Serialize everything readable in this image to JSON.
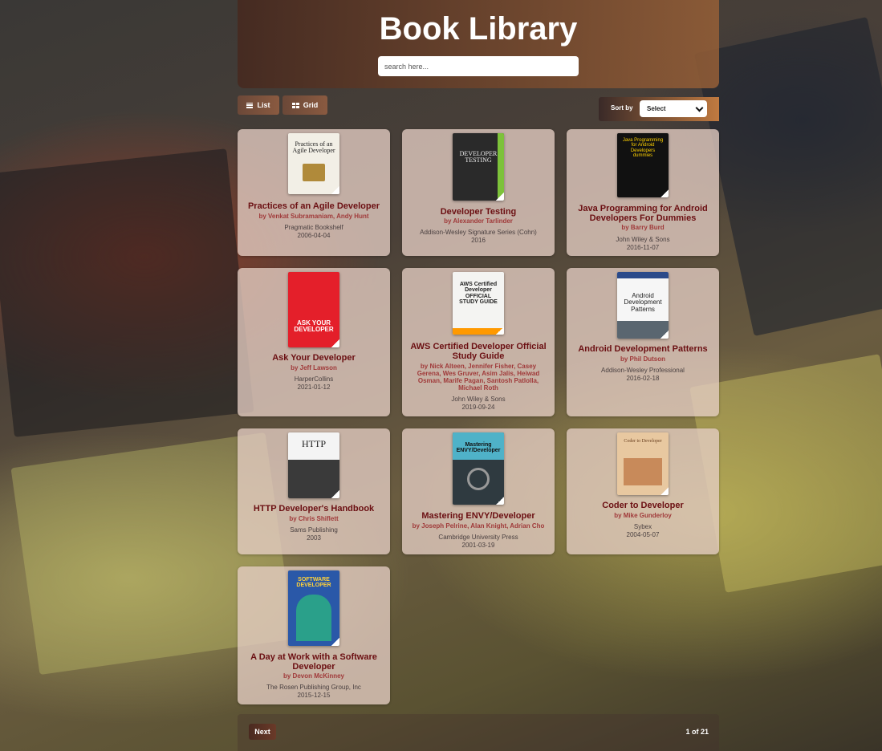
{
  "header": {
    "title": "Book Library",
    "search_placeholder": "search here..."
  },
  "view": {
    "list_label": "List",
    "grid_label": "Grid"
  },
  "sort": {
    "label": "Sort by",
    "selected": "Select"
  },
  "books": [
    {
      "title": "Practices of an Agile Developer",
      "authors": "by Venkat Subramaniam, Andy Hunt",
      "publisher": "Pragmatic Bookshelf",
      "date": "2006-04-04",
      "cover_text": "Practices of an Agile Developer",
      "cover_color": "#f2efe6"
    },
    {
      "title": "Developer Testing",
      "authors": "by Alexander Tarlinder",
      "publisher": "Addison-Wesley Signature Series (Cohn)",
      "date": "2016",
      "cover_text": "DEVELOPER TESTING",
      "cover_color": "#2a2a2a"
    },
    {
      "title": "Java Programming for Android Developers For Dummies",
      "authors": "by Barry Burd",
      "publisher": "John Wiley & Sons",
      "date": "2016-11-07",
      "cover_text": "Java Programming for Android Developers dummies",
      "cover_color": "#111111"
    },
    {
      "title": "Ask Your Developer",
      "authors": "by Jeff Lawson",
      "publisher": "HarperCollins",
      "date": "2021-01-12",
      "cover_text": "ASK YOUR DEVELOPER",
      "cover_color": "#e41f2a"
    },
    {
      "title": "AWS Certified Developer Official Study Guide",
      "authors": "by Nick Alteen, Jennifer Fisher, Casey Gerena, Wes Gruver, Asim Jalis, Heiwad Osman, Marife Pagan, Santosh Patlolla, Michael Roth",
      "publisher": "John Wiley & Sons",
      "date": "2019-09-24",
      "cover_text": "AWS Certified Developer OFFICIAL STUDY GUIDE",
      "cover_color": "#f4f4f2"
    },
    {
      "title": "Android Development Patterns",
      "authors": "by Phil Dutson",
      "publisher": "Addison-Wesley Professional",
      "date": "2016-02-18",
      "cover_text": "Android Development Patterns",
      "cover_color": "#f6f6f6"
    },
    {
      "title": "HTTP Developer's Handbook",
      "authors": "by Chris Shiflett",
      "publisher": "Sams Publishing",
      "date": "2003",
      "cover_text": "HTTP",
      "cover_color": "#f4f4f4"
    },
    {
      "title": "Mastering ENVY/Developer",
      "authors": "by Joseph Pelrine, Alan Knight, Adrian Cho",
      "publisher": "Cambridge University Press",
      "date": "2001-03-19",
      "cover_text": "Mastering ENVY/Developer",
      "cover_color": "#2f3a40"
    },
    {
      "title": "Coder to Developer",
      "authors": "by Mike Gunderloy",
      "publisher": "Sybex",
      "date": "2004-05-07",
      "cover_text": "Coder to Developer",
      "cover_color": "#e8c8a0"
    },
    {
      "title": "A Day at Work with a Software Developer",
      "authors": "by Devon McKinney",
      "publisher": "The Rosen Publishing Group, Inc",
      "date": "2015-12-15",
      "cover_text": "SOFTWARE DEVELOPER",
      "cover_color": "#2a58a8"
    }
  ],
  "pagination": {
    "next_label": "Next",
    "page_info": "1 of 21"
  }
}
